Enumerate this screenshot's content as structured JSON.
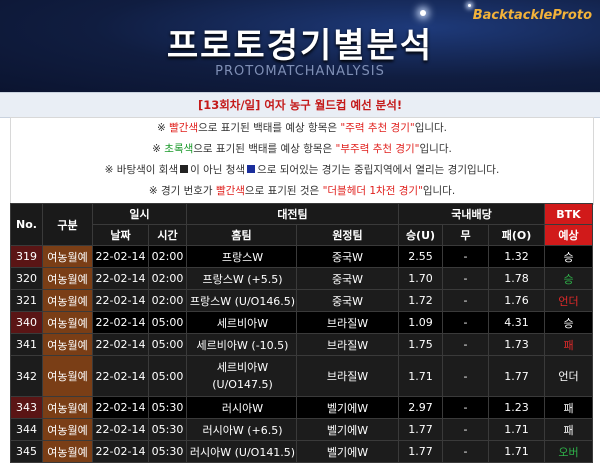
{
  "banner": {
    "title": "프로토경기별분석",
    "subtitle": "PROTOMATCHANALYSIS",
    "brand": "BacktackleProto"
  },
  "subheader": {
    "prefix": "[13회차/일]",
    "text": "여자 농구 월드컵 예선 분석!"
  },
  "notices": [
    {
      "pre": "※ ",
      "colored": "빨간색",
      "color": "red",
      "mid": "으로 표기된 백태를 예상 항목은 ",
      "quoted": "\"주력 추천 경기\"",
      "post": "입니다."
    },
    {
      "pre": "※ ",
      "colored": "초록색",
      "color": "green",
      "mid": "으로 표기된 백태를 예상 항목은 ",
      "quoted": "\"부주력 추천 경기\"",
      "post": "입니다."
    },
    {
      "text1": "※ 바탕색이 회색",
      "text2": "이 아닌 청색",
      "text3": "으로 되어있는 경기는 중립지역에서 열리는 경기입니다."
    },
    {
      "pre": "※ 경기 번호가 ",
      "colored": "빨간색",
      "color": "red",
      "mid": "으로 표기된 것은 ",
      "quoted": "\"더블헤더 1차전 경기\"",
      "post": "입니다."
    }
  ],
  "table": {
    "headers": {
      "no": "No.",
      "category": "구분",
      "datetime": "일시",
      "date": "날짜",
      "time": "시간",
      "matchup": "대전팀",
      "home": "홈팀",
      "away": "원정팀",
      "odds": "국내배당",
      "win": "승(U)",
      "draw": "무",
      "lose": "패(O)",
      "btk": "BTK",
      "pred": "예상"
    },
    "rows": [
      {
        "no": "319",
        "cat": "여농월예",
        "date": "22-02-14",
        "time": "02:00",
        "home": "프랑스W",
        "away": "중국W",
        "win": "2.55",
        "draw": "-",
        "lose": "1.32",
        "pred": "승",
        "pred_color": "white"
      },
      {
        "no": "320",
        "cat": "여농월예",
        "date": "22-02-14",
        "time": "02:00",
        "home": "프랑스W (+5.5)",
        "away": "중국W",
        "win": "1.70",
        "draw": "-",
        "lose": "1.78",
        "pred": "승",
        "pred_color": "green"
      },
      {
        "no": "321",
        "cat": "여농월예",
        "date": "22-02-14",
        "time": "02:00",
        "home": "프랑스W (U/O146.5)",
        "away": "중국W",
        "win": "1.72",
        "draw": "-",
        "lose": "1.76",
        "pred": "언더",
        "pred_color": "red"
      },
      {
        "no": "340",
        "cat": "여농월예",
        "date": "22-02-14",
        "time": "05:00",
        "home": "세르비아W",
        "away": "브라질W",
        "win": "1.09",
        "draw": "-",
        "lose": "4.31",
        "pred": "승",
        "pred_color": "white"
      },
      {
        "no": "341",
        "cat": "여농월예",
        "date": "22-02-14",
        "time": "05:00",
        "home": "세르비아W (-10.5)",
        "away": "브라질W",
        "win": "1.75",
        "draw": "-",
        "lose": "1.73",
        "pred": "패",
        "pred_color": "red"
      },
      {
        "no": "342",
        "cat": "여농월예",
        "date": "22-02-14",
        "time": "05:00",
        "home": "세르비아W (U/O147.5)",
        "away": "브라질W",
        "win": "1.71",
        "draw": "-",
        "lose": "1.77",
        "pred": "언더",
        "pred_color": "white"
      },
      {
        "no": "343",
        "cat": "여농월예",
        "date": "22-02-14",
        "time": "05:30",
        "home": "러시아W",
        "away": "벨기에W",
        "win": "2.97",
        "draw": "-",
        "lose": "1.23",
        "pred": "패",
        "pred_color": "white"
      },
      {
        "no": "344",
        "cat": "여농월예",
        "date": "22-02-14",
        "time": "05:30",
        "home": "러시아W (+6.5)",
        "away": "벨기에W",
        "win": "1.77",
        "draw": "-",
        "lose": "1.71",
        "pred": "패",
        "pred_color": "white"
      },
      {
        "no": "345",
        "cat": "여농월예",
        "date": "22-02-14",
        "time": "05:30",
        "home": "러시아W (U/O141.5)",
        "away": "벨기에W",
        "win": "1.77",
        "draw": "-",
        "lose": "1.71",
        "pred": "오버",
        "pred_color": "green"
      }
    ]
  },
  "colors": {
    "red": "#e0201d",
    "green": "#1b9a2b",
    "banner": "#0e1836",
    "btk_header": "#d11a1a"
  }
}
